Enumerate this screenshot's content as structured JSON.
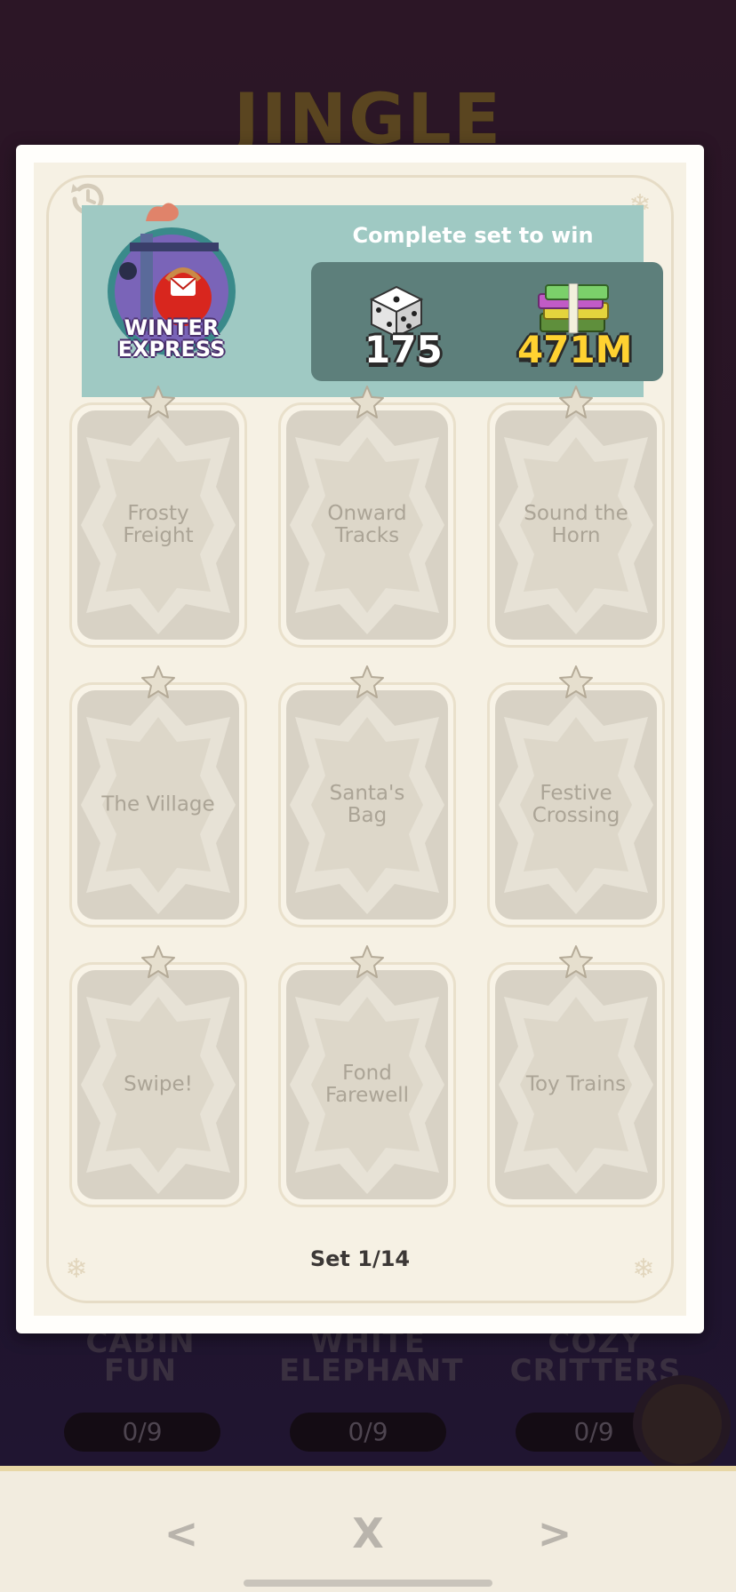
{
  "background": {
    "album_title": "JINGLE",
    "sets": [
      {
        "name": "CABIN FUN",
        "progress": "0/9"
      },
      {
        "name": "WHITE ELEPHANT",
        "progress": "0/9"
      },
      {
        "name": "COZY CRITTERS",
        "progress": "0/9"
      }
    ]
  },
  "panel": {
    "set_name": "WINTER EXPRESS",
    "set_name_line1": "WINTER",
    "set_name_line2": "EXPRESS",
    "reward_heading": "Complete set to win",
    "rewards": {
      "dice": "175",
      "cash": "471M"
    },
    "stickers": [
      "Frosty Freight",
      "Onward Tracks",
      "Sound the Horn",
      "The Village",
      "Santa's Bag",
      "Festive Crossing",
      "Swipe!",
      "Fond Farewell",
      "Toy Trains"
    ],
    "stickers_l1": [
      "Frosty",
      "Onward",
      "Sound the",
      "The Village",
      "Santa's",
      "Festive",
      "Swipe!",
      "Fond",
      "Toy Trains"
    ],
    "stickers_l2": [
      "Freight",
      "Tracks",
      "Horn",
      "",
      "Bag",
      "Crossing",
      "",
      "Farewell",
      ""
    ],
    "set_counter": "Set 1/14"
  },
  "nav": {
    "prev": "<",
    "close": "X",
    "next": ">"
  },
  "colors": {
    "header_teal": "#9fc9c3",
    "reward_box": "#5d7f7b",
    "cash_yellow": "#ffd231",
    "paper": "#f6f1e4"
  }
}
